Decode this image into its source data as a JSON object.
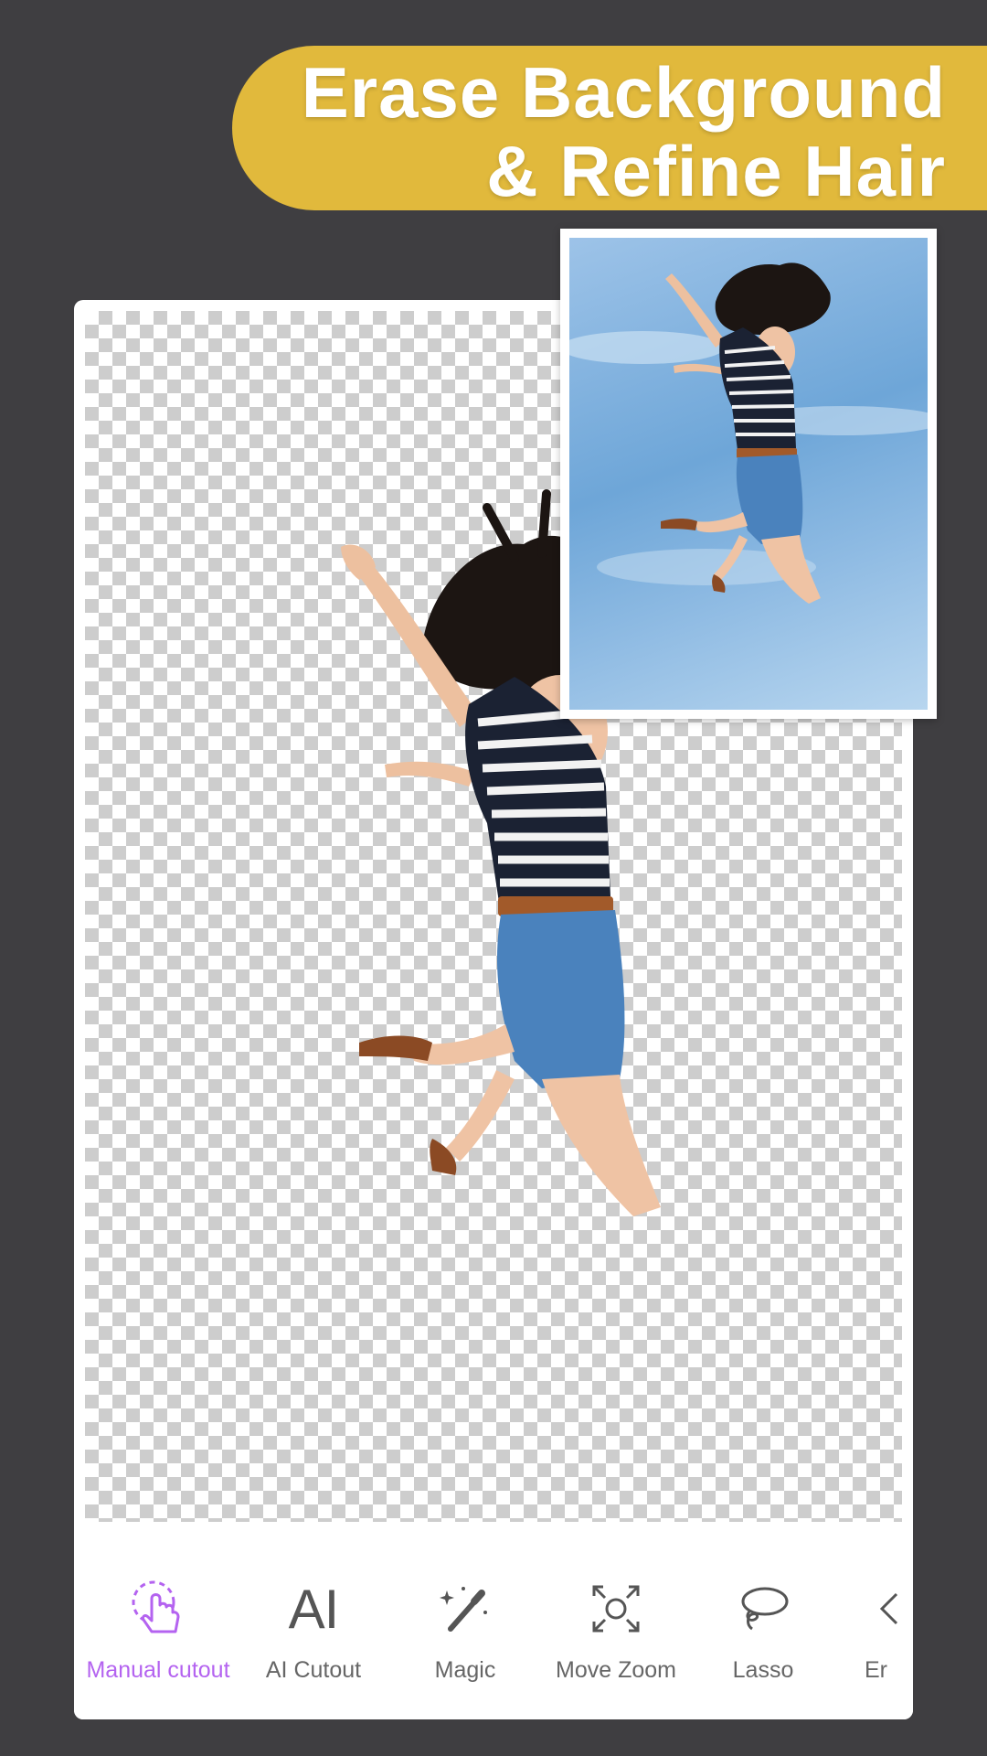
{
  "banner": {
    "line1": "Erase Background",
    "line2": "& Refine Hair"
  },
  "colors": {
    "background": "#3f3e41",
    "banner": "#e1b93c",
    "accent": "#b463f0",
    "tool_label": "#666666"
  },
  "toolbar": {
    "tools": [
      {
        "label": "Manual cutout",
        "icon": "hand-pointer-icon",
        "active": true
      },
      {
        "label": "AI Cutout",
        "icon": "ai-text-icon",
        "active": false
      },
      {
        "label": "Magic",
        "icon": "magic-wand-icon",
        "active": false
      },
      {
        "label": "Move Zoom",
        "icon": "move-zoom-icon",
        "active": false
      },
      {
        "label": "Lasso",
        "icon": "lasso-icon",
        "active": false
      },
      {
        "label": "Er",
        "icon": "eraser-icon",
        "active": false
      }
    ],
    "ai_glyph": "AI"
  }
}
